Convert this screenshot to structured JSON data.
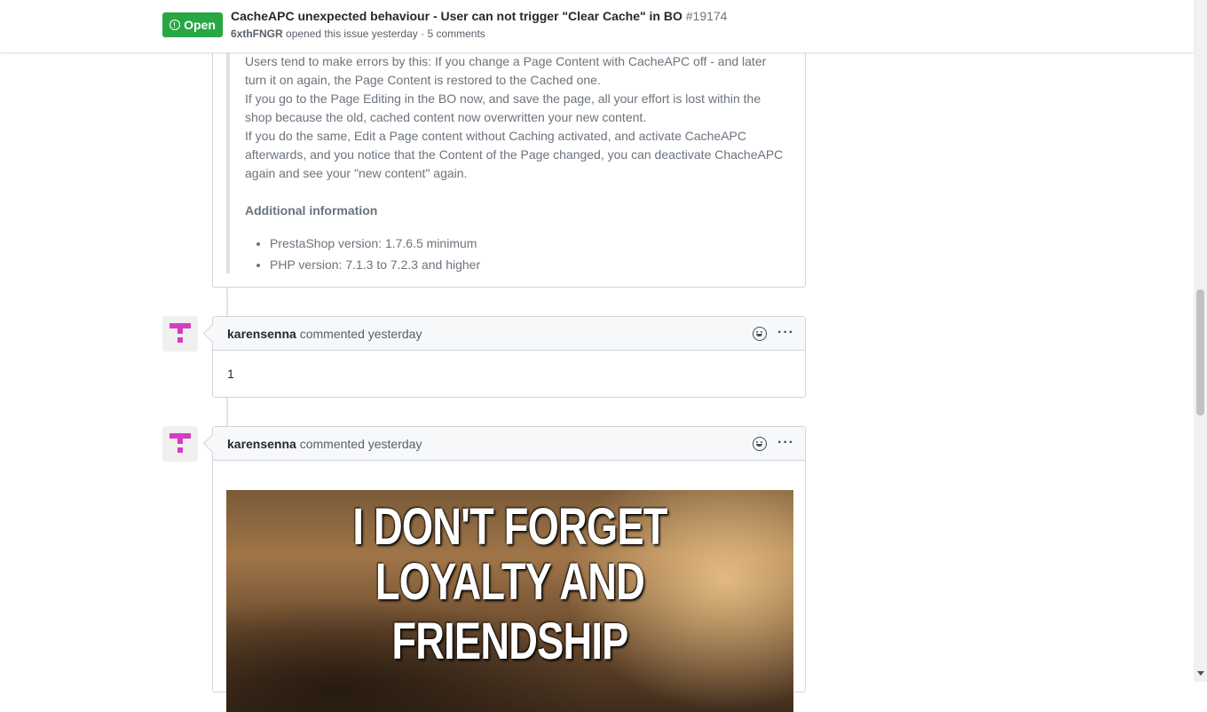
{
  "header": {
    "state": "Open",
    "title": "CacheAPC unexpected behaviour - User can not trigger \"Clear Cache\" in BO",
    "number": "#19174",
    "author": "6xthFNGR",
    "meta_text": "opened this issue yesterday · 5 comments"
  },
  "first_comment": {
    "paragraph": "Users tend to make errors by this: If you change a Page Content with CacheAPC off - and later turn it on again, the Page Content is restored to the Cached one.\nIf you go to the Page Editing in the BO now, and save the page, all your effort is lost within the shop because the old, cached content now overwritten your new content.\nIf you do the same, Edit a Page content without Caching activated, and activate CacheAPC afterwards, and you notice that the Content of the Page changed, you can deactivate ChacheAPC again and see your \"new content\" again.",
    "line1": "Users tend to make errors by this: If you change a Page Content with CacheAPC off - and later turn it on again, the Page Content is restored to the Cached one.",
    "line2": "If you go to the Page Editing in the BO now, and save the page, all your effort is lost within the shop because the old, cached content now overwritten your new content.",
    "line3": "If you do the same, Edit a Page content without Caching activated, and activate CacheAPC afterwards, and you notice that the Content of the Page changed, you can deactivate ChacheAPC again and see your \"new content\" again.",
    "additional_heading": "Additional information",
    "list": [
      "PrestaShop version: 1.7.6.5 minimum",
      "PHP version: 7.1.3 to 7.2.3 and higher"
    ]
  },
  "comments": [
    {
      "login": "karensenna",
      "action": "commented yesterday",
      "body": "1"
    },
    {
      "login": "karensenna",
      "action": "commented yesterday",
      "image_text_line1": "I DON'T FORGET",
      "image_text_line2": "LOYALTY AND FRIENDSHIP"
    }
  ],
  "icons": {
    "state": "issue-opened-icon",
    "reaction": "smiley-icon",
    "more": "kebab-horizontal-icon"
  },
  "colors": {
    "open_green": "#28a745",
    "avatar_magenta": "#d43fbf"
  }
}
